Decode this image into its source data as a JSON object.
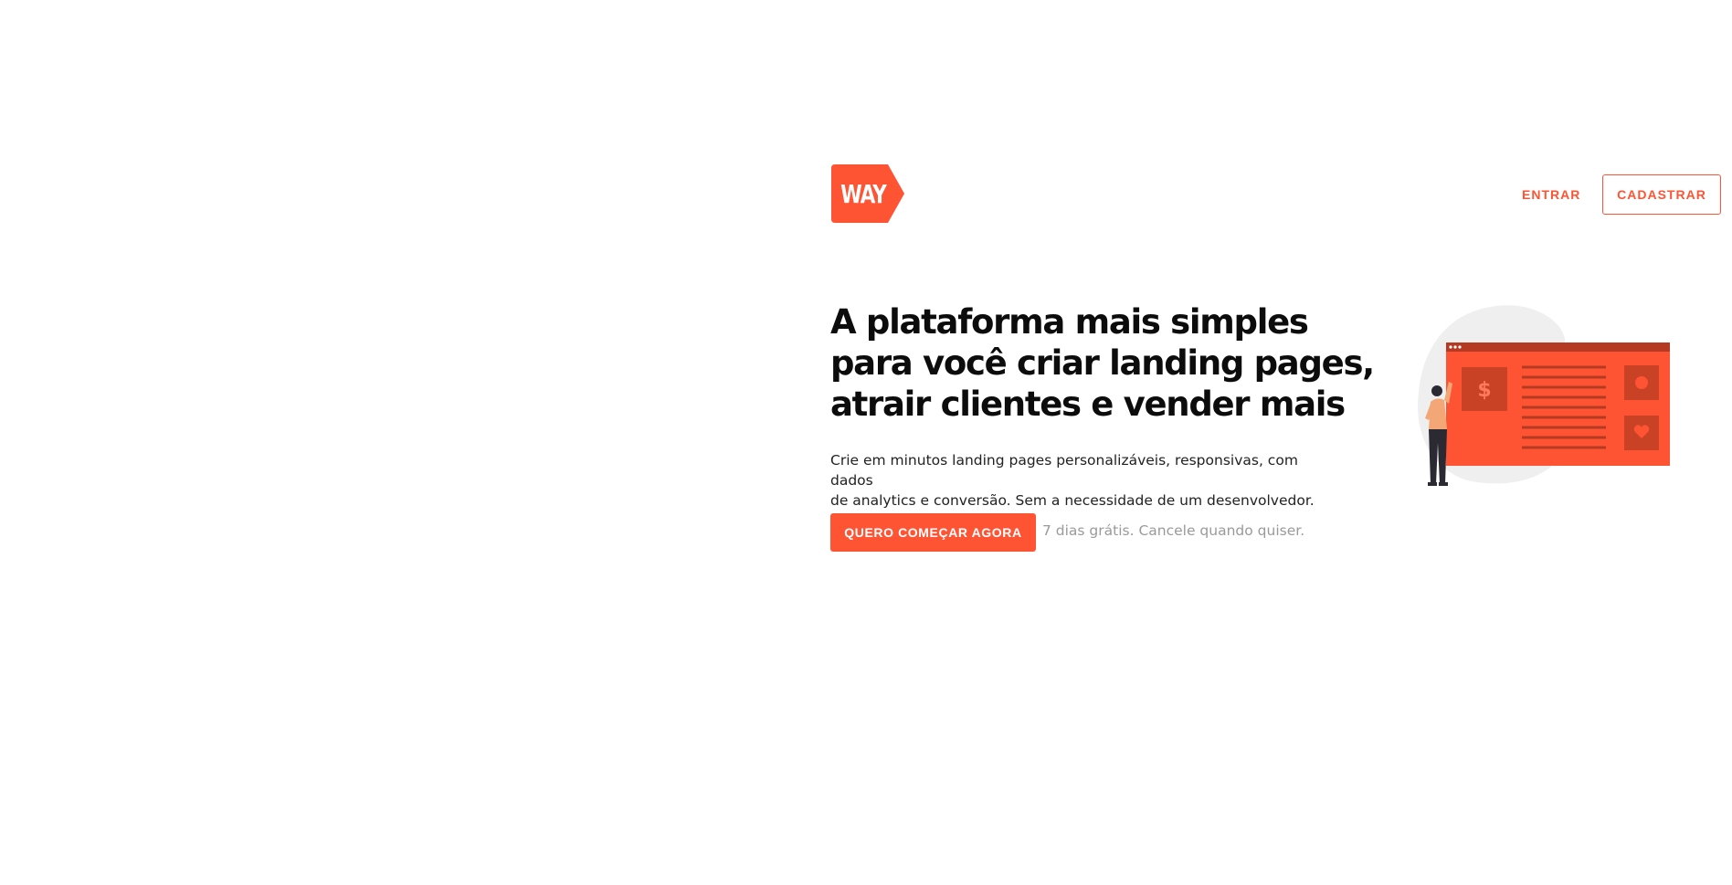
{
  "brand": {
    "logo_text": "WAY",
    "accent_color": "#ff5434"
  },
  "nav": {
    "login_label": "ENTRAR",
    "signup_label": "CADASTRAR"
  },
  "hero": {
    "title_lines": [
      "A plataforma mais simples",
      "para você criar landing pages,",
      "atrair clientes e vender mais"
    ],
    "subtitle_lines": [
      "Crie em minutos landing pages personalizáveis, responsivas, com dados",
      "de analytics e conversão. Sem a necessidade de um desenvolvedor."
    ],
    "cta_label": "QUERO COMEÇAR AGORA",
    "cta_note": "7 dias grátis. Cancele quando quiser."
  },
  "illustration": {
    "icons": [
      "dollar-icon",
      "heart-icon"
    ]
  }
}
